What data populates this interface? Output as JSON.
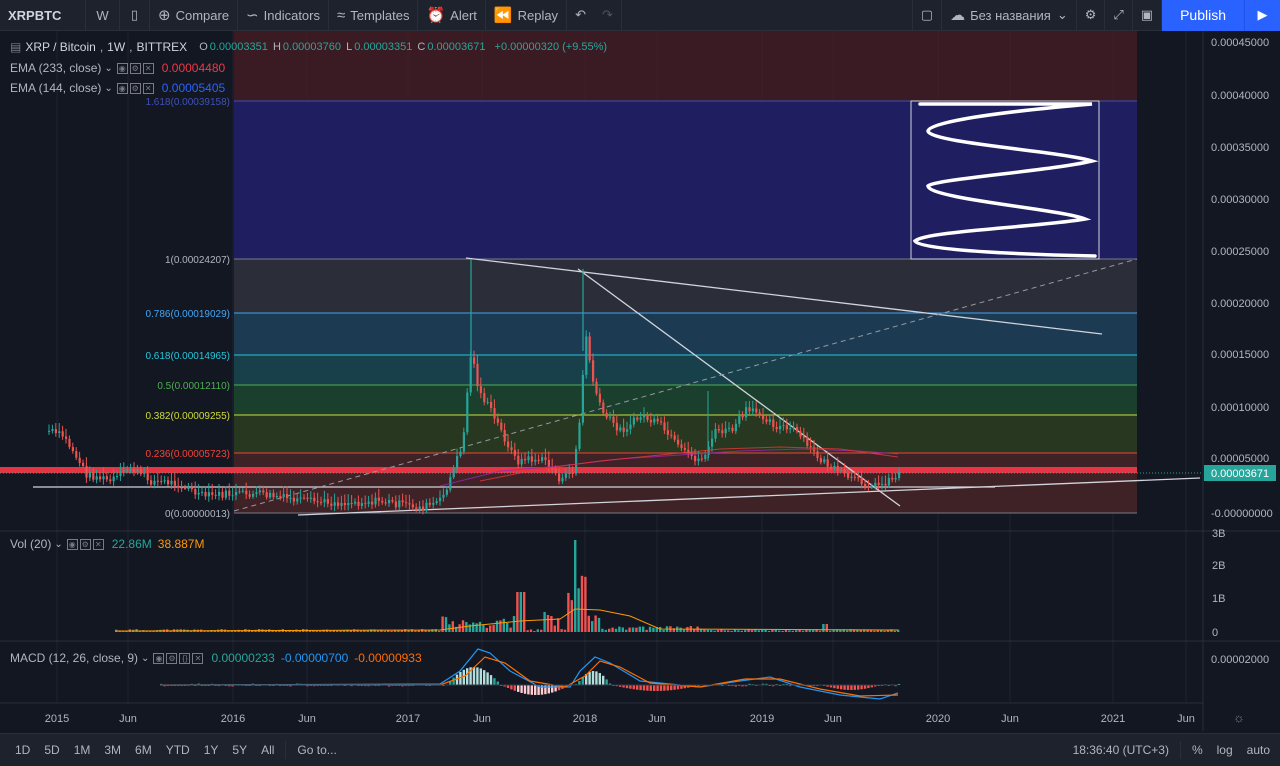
{
  "toolbar": {
    "symbol": "XRPBTC",
    "interval": "W",
    "compare": "Compare",
    "indicators": "Indicators",
    "templates": "Templates",
    "alert": "Alert",
    "replay": "Replay",
    "layout_name": "Без названия",
    "publish": "Publish"
  },
  "legend": {
    "title": "XRP / Bitcoin",
    "interval": "1W",
    "exchange": "BITTREX",
    "o_label": "O",
    "o": "0.00003351",
    "h_label": "H",
    "h": "0.00003760",
    "l_label": "L",
    "l": "0.00003351",
    "c_label": "C",
    "c": "0.00003671",
    "change": "+0.00000320 (+9.55%)",
    "ema1_label": "EMA (233, close)",
    "ema1_value": "0.00004480",
    "ema2_label": "EMA (144, close)",
    "ema2_value": "0.00005405",
    "vol_label": "Vol (20)",
    "vol_value1": "22.86M",
    "vol_value2": "38.887M",
    "macd_label": "MACD (12, 26, close, 9)",
    "macd_v1": "0.00000233",
    "macd_v2": "-0.00000700",
    "macd_v3": "-0.00000933"
  },
  "fib_levels": [
    {
      "label": "1.618(0.00039158)",
      "color": "#3f51b5"
    },
    {
      "label": "1(0.00024207)",
      "color": "#787b86"
    },
    {
      "label": "0.786(0.00019029)",
      "color": "#42a5f5"
    },
    {
      "label": "0.618(0.00014965)",
      "color": "#26c6da"
    },
    {
      "label": "0.5(0.00012110)",
      "color": "#4caf50"
    },
    {
      "label": "0.382(0.00009255)",
      "color": "#cddc39"
    },
    {
      "label": "0.236(0.00005723)",
      "color": "#f44336"
    },
    {
      "label": "0(0.00000013)",
      "color": "#787b86"
    }
  ],
  "price_axis": [
    "0.00045000",
    "0.00040000",
    "0.00035000",
    "0.00030000",
    "0.00025000",
    "0.00020000",
    "0.00015000",
    "0.00010000",
    "0.00005000",
    "0.00003671",
    "-0.00000000"
  ],
  "vol_axis": [
    "3B",
    "2B",
    "1B",
    "0"
  ],
  "macd_axis": [
    "0.00002000"
  ],
  "time_axis": [
    "2015",
    "Jun",
    "2016",
    "Jun",
    "2017",
    "Jun",
    "2018",
    "Jun",
    "2019",
    "Jun",
    "2020",
    "Jun",
    "2021",
    "Jun"
  ],
  "bottom": {
    "ranges": [
      "1D",
      "5D",
      "1M",
      "3M",
      "6M",
      "YTD",
      "1Y",
      "5Y",
      "All"
    ],
    "goto": "Go to...",
    "time": "18:36:40 (UTC+3)",
    "percent": "%",
    "log": "log",
    "auto": "auto"
  },
  "colors": {
    "up": "#26a69a",
    "down": "#ef5350",
    "accent": "#2962ff"
  }
}
